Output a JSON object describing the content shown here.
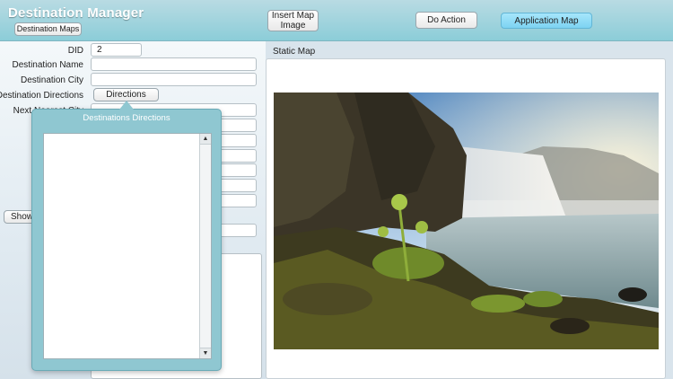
{
  "app": {
    "title": "Destination Manager"
  },
  "header": {
    "destination_maps_button": "Destination Maps",
    "insert_map_image_button": "Insert Map\nImage",
    "do_action_button": "Do Action",
    "application_map_button": "Application Map"
  },
  "form": {
    "did_label": "DID",
    "did_value": "2",
    "name_label": "Destination Name",
    "name_value": "",
    "city_label": "Destination City",
    "city_value": "",
    "directions_label": "Destination Directions",
    "directions_button": "Directions",
    "nearest_city_label": "Next Nearest City",
    "show_button": "Show"
  },
  "map": {
    "label": "Static Map",
    "image_description_icon": "waterfall-landscape-photo"
  },
  "popover": {
    "title": "Destinations Directions",
    "scroll_up_glyph": "▲",
    "scroll_down_glyph": "▼"
  },
  "colors": {
    "header_top": "#b9dbe3",
    "header_bottom": "#8ccdd8",
    "accent_button": "#7dd3f2",
    "popover": "#8fc7d1"
  }
}
